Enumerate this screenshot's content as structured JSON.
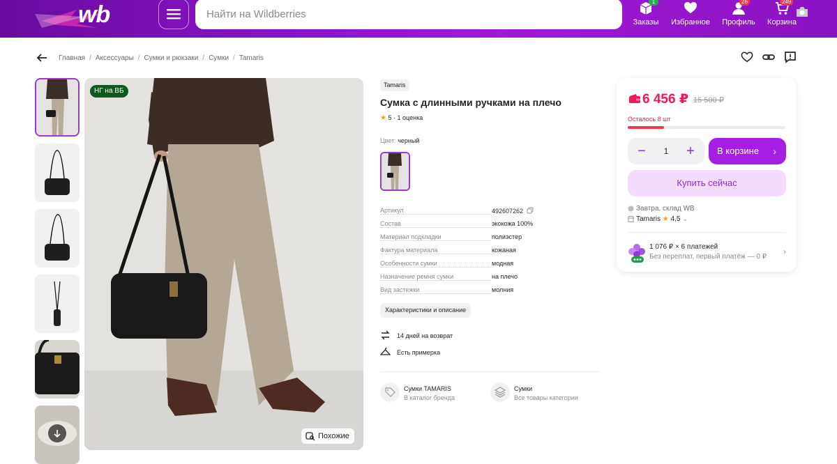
{
  "header": {
    "logo": "wb",
    "search_placeholder": "Найти на Wildberries",
    "nav": [
      {
        "label": "Заказы",
        "icon": "box-icon",
        "badge": "1",
        "badge_color": "#22b04b"
      },
      {
        "label": "Избранное",
        "icon": "heart-icon",
        "badge": "",
        "badge_color": ""
      },
      {
        "label": "Профиль",
        "icon": "user-icon",
        "badge": "26",
        "badge_color": "#f0364a"
      },
      {
        "label": "Корзина",
        "icon": "cart-icon",
        "badge": "249",
        "badge_color": "#f0364a"
      }
    ]
  },
  "breadcrumbs": [
    "Главная",
    "Аксессуары",
    "Сумки и рюкзаки",
    "Сумки",
    "Tamaris"
  ],
  "gallery": {
    "badge": "НГ на ВБ",
    "similar_label": "Похожие"
  },
  "product": {
    "brand": "Tamaris",
    "title": "Сумка с длинными ручками на плечо",
    "rating": "5",
    "reviews": "1 оценка",
    "color_label": "Цвет:",
    "color_value": "черный",
    "specs": [
      {
        "key": "Артикул",
        "value": "492607262"
      },
      {
        "key": "Состав",
        "value": "экокожа 100%"
      },
      {
        "key": "Материал подкладки",
        "value": "полиэстер"
      },
      {
        "key": "Фактура материала",
        "value": "кожаная"
      },
      {
        "key": "Особенности сумки",
        "value": "модная"
      },
      {
        "key": "Назначение ремня сумки",
        "value": "на плечо"
      },
      {
        "key": "Вид застежки",
        "value": "молния"
      }
    ],
    "char_button": "Характеристики и описание",
    "features": [
      "14 дней на возврат",
      "Есть примерка"
    ],
    "categories": [
      {
        "title": "Сумки TAMARIS",
        "subtitle": "В каталог бренда"
      },
      {
        "title": "Сумки",
        "subtitle": "Все товары категории"
      }
    ]
  },
  "buy": {
    "price": "6 456 ₽",
    "old_price": "15 500 ₽",
    "stock_text": "Осталось 8 шт",
    "stock_fraction": 0.23,
    "quantity": "1",
    "cart_button": "В корзине",
    "buy_now": "Купить сейчас",
    "delivery": "Завтра, склад WB",
    "seller": "Tamaris",
    "seller_rating": "4,5",
    "installment_title": "1 076 ₽ × 6 платежей",
    "installment_sub": "Без переплат, первый платёж — 0 ₽"
  },
  "colors": {
    "accent": "#a41ee3",
    "price": "#f01859",
    "header_start": "#6a0a9e",
    "header_end": "#a11ad6"
  }
}
